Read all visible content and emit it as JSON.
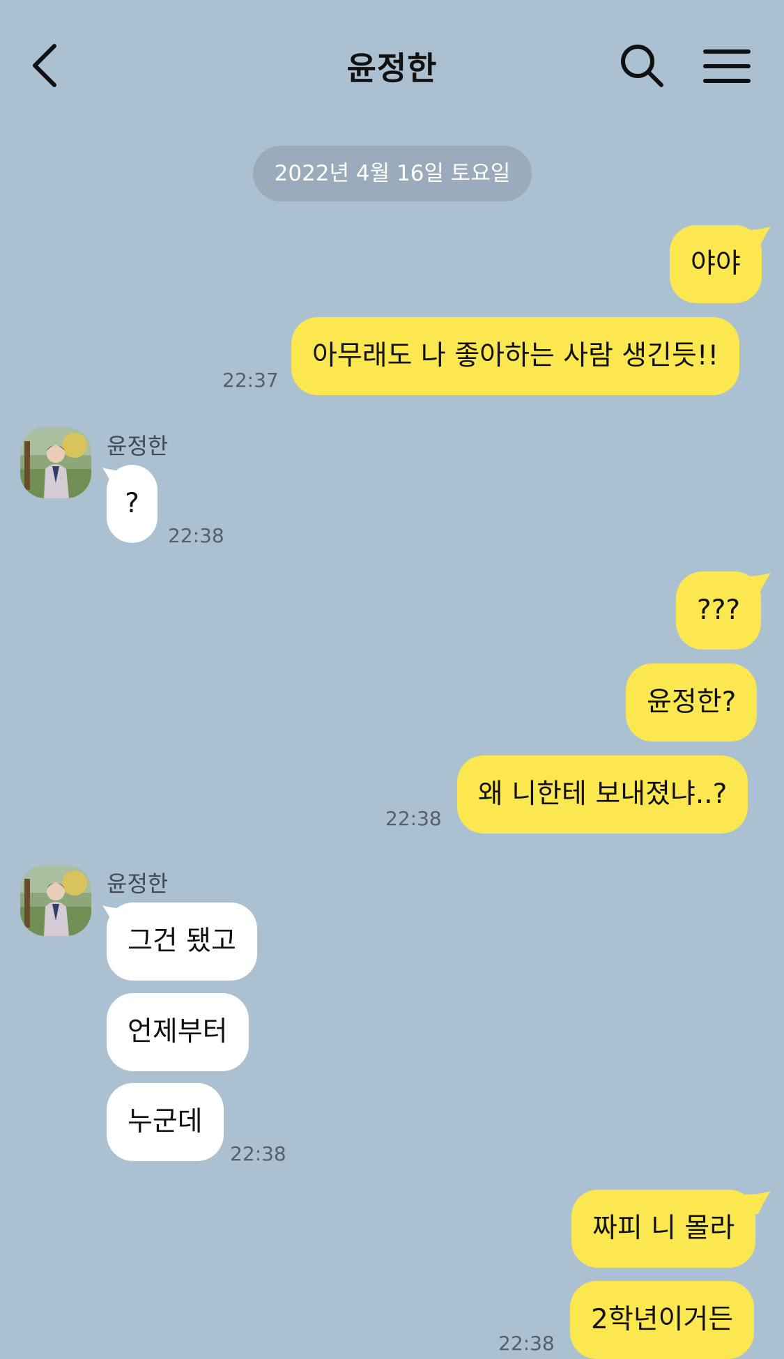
{
  "header": {
    "title": "윤정한"
  },
  "date_divider": "2022년 4월 16일 토요일",
  "messages": {
    "m1": "야야",
    "m2": "아무래도 나 좋아하는 사람 생긴듯!!",
    "t1": "22:37",
    "sender1": "윤정한",
    "m3": "?",
    "t2": "22:38",
    "m4": "???",
    "m5": "윤정한?",
    "m6": "왜 니한테 보내졌냐..?",
    "t3": "22:38",
    "sender2": "윤정한",
    "m7": "그건 됐고",
    "m8": "언제부터",
    "m9": "누군데",
    "t4": "22:38",
    "m10": "짜피 니 몰라",
    "m11": "2학년이거든",
    "t5": "22:38"
  },
  "colors": {
    "background": "#abc1d1",
    "my_bubble": "#fbe74f",
    "their_bubble": "#ffffff"
  },
  "icons": {
    "back": "chevron-left-icon",
    "search": "search-icon",
    "menu": "hamburger-menu-icon"
  }
}
